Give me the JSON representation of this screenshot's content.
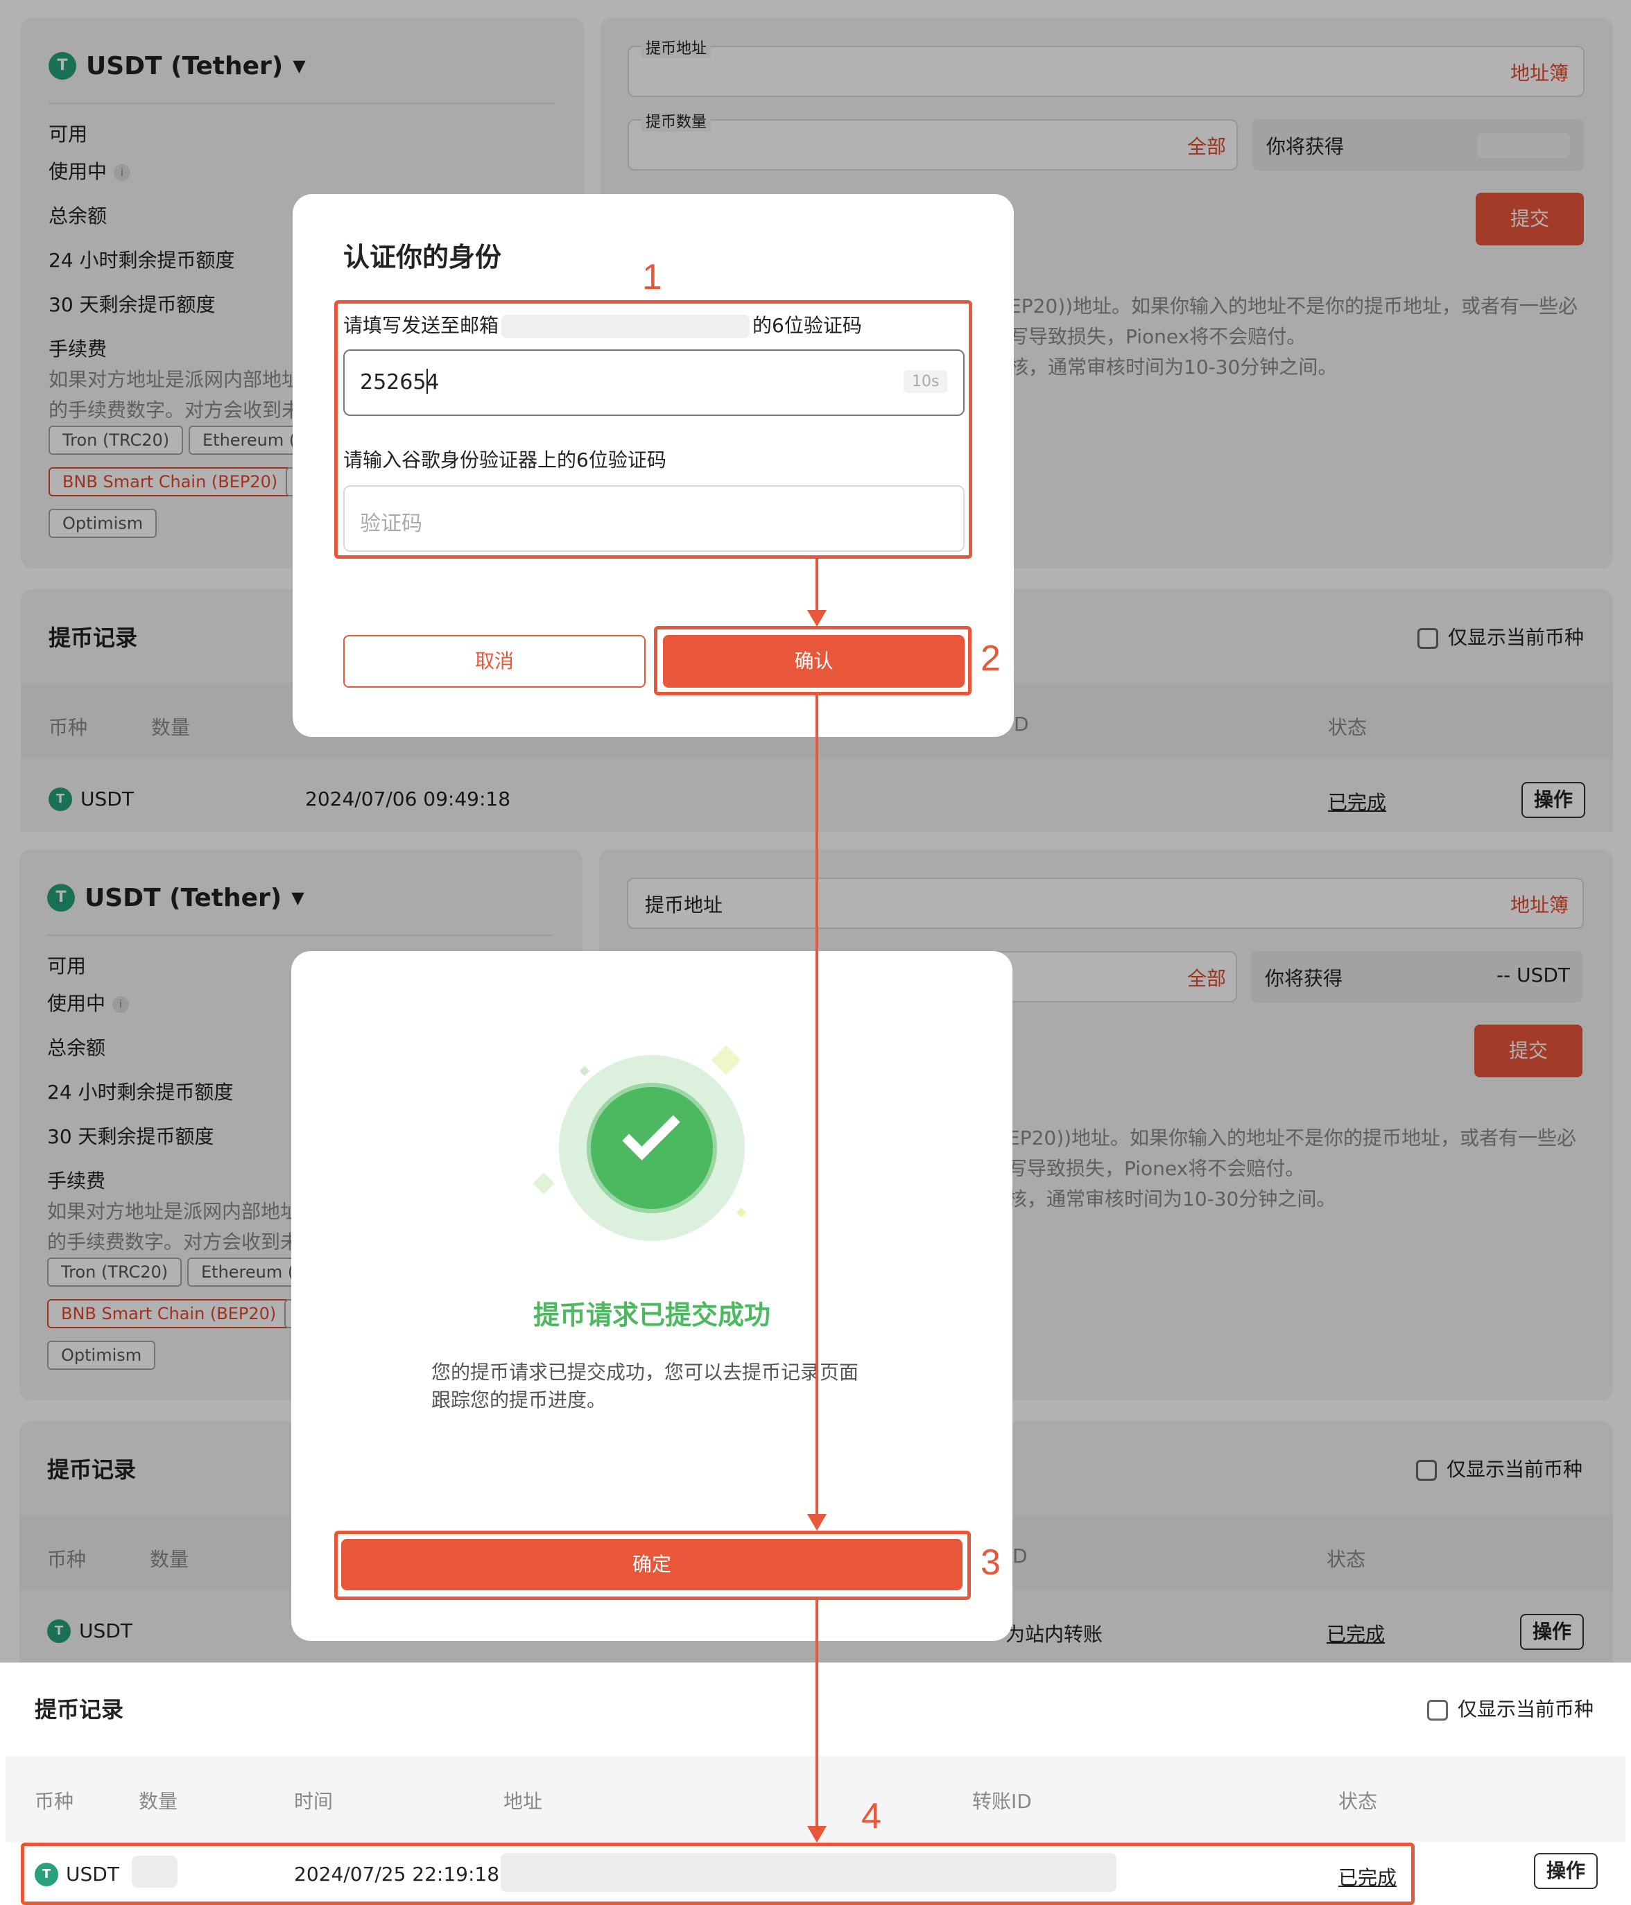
{
  "coin": {
    "name": "USDT (Tether)",
    "symbol": "USDT",
    "icon": "tether-icon",
    "icon_letter": "T"
  },
  "balances": {
    "available": "可用",
    "in_use": "使用中",
    "total": "总余额",
    "limit_24h": "24 小时剩余提币额度",
    "limit_30d": "30 天剩余提币额度"
  },
  "fee": {
    "title": "手续费",
    "line1": "如果对方地址是派网内部地址",
    "line2": "的手续费数字。对方会收到未"
  },
  "networks": {
    "tron": "Tron (TRC20)",
    "eth": "Ethereum (E",
    "bnb": "BNB Smart Chain (BEP20)",
    "optimism": "Optimism"
  },
  "form": {
    "address_label": "提币地址",
    "address_book": "地址簿",
    "amount_label": "提币数量",
    "all": "全部",
    "you_get": "你将获得",
    "you_get_value": "-- USDT",
    "submit": "提交"
  },
  "notice": {
    "line1": "EP20))地址。如果你输入的地址不是你的提币地址，或者有一些必",
    "line2": "写导致损失，Pionex将不会赔付。",
    "line3": "核，通常审核时间为10-30分钟之间。"
  },
  "records": {
    "title": "提币记录",
    "only_current": "仅显示当前币种",
    "columns": {
      "coin": "币种",
      "amount": "数量",
      "time": "时间",
      "address": "地址",
      "txid": "转账ID",
      "txid_partial": "D",
      "status": "状态"
    },
    "row1": {
      "coin": "USDT",
      "time": "2024/07/06 09:49:18",
      "status": "已完成",
      "action": "操作"
    },
    "row2": {
      "coin": "USDT",
      "note": "为站内转账",
      "status": "已完成",
      "action": "操作"
    },
    "row3": {
      "coin": "USDT",
      "time": "2024/07/25 22:19:18",
      "status": "已完成",
      "action": "操作"
    }
  },
  "verify_modal": {
    "title": "认证你的身份",
    "email_prefix": "请填写发送至邮箱",
    "email_suffix": "的6位验证码",
    "email_code": "252654",
    "countdown": "10s",
    "google_label": "请输入谷歌身份验证器上的6位验证码",
    "google_placeholder": "验证码",
    "cancel": "取消",
    "confirm": "确认"
  },
  "success_modal": {
    "title": "提币请求已提交成功",
    "desc1": "您的提币请求已提交成功，您可以去提币记录页面",
    "desc2": "跟踪您的提币进度。",
    "ok": "确定"
  },
  "steps": {
    "s1": "1",
    "s2": "2",
    "s3": "3",
    "s4": "4"
  },
  "colors": {
    "accent": "#e8573a",
    "success": "#4cb860",
    "tether": "#26a17b"
  }
}
